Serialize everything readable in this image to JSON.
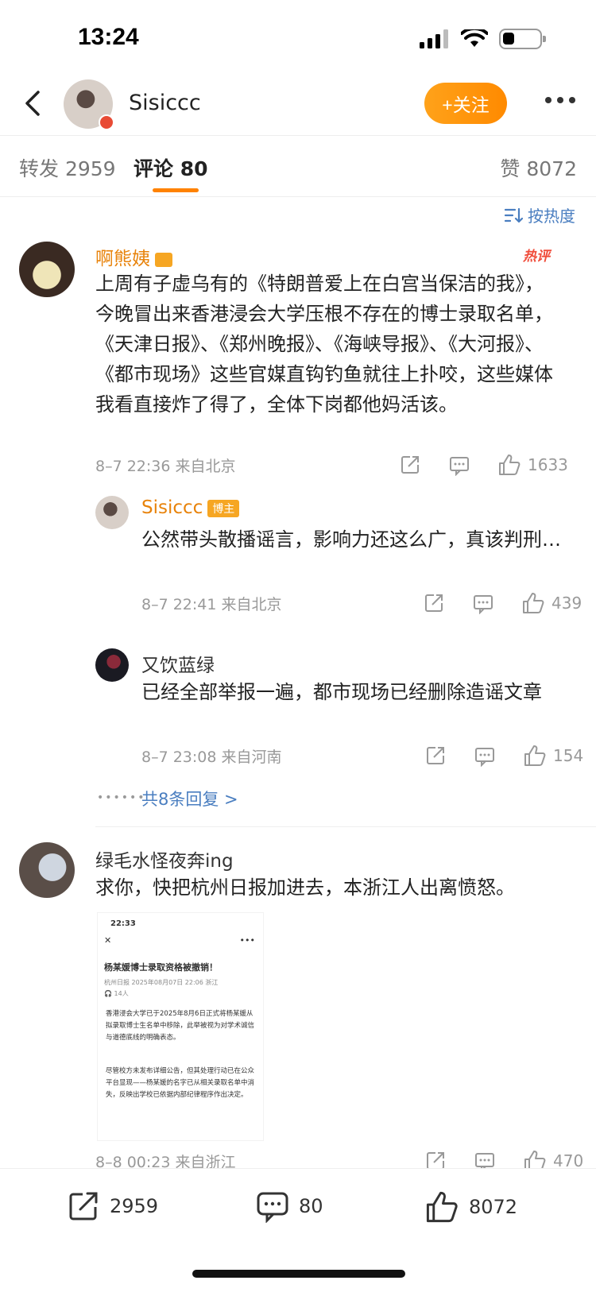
{
  "status": {
    "time": "13:24"
  },
  "header": {
    "user_name": "Sisiccc",
    "follow_label": "+关注"
  },
  "tabs": [
    {
      "label": "转发 2959"
    },
    {
      "label": "评论 80"
    },
    {
      "label": "赞 8072"
    }
  ],
  "sort_label": "按热度",
  "comments": [
    {
      "name": "啊熊姨",
      "hot_tag": "热评",
      "text": "上周有子虚乌有的《特朗普爱上在白宫当保洁的我》，今晚冒出来香港浸会大学压根不存在的博士录取名单，《天津日报》、《郑州晚报》、《海峡导报》、《大河报》、《都市现场》这些官媒直钩钓鱼就往上扑咬，这些媒体我看直接炸了得了，全体下岗都他妈活该。",
      "meta": "8–7 22:36 来自北京",
      "likes": "1633",
      "replies": [
        {
          "name": "Sisiccc",
          "badge": "博主",
          "text": "公然带头散播谣言，影响力还这么广，真该判刑…",
          "meta": "8–7 22:41 来自北京",
          "likes": "439"
        },
        {
          "name": "又饮蓝绿",
          "text": "已经全部举报一遍，都市现场已经删除造谣文章",
          "meta": "8–7 23:08 来自河南",
          "likes": "154"
        }
      ],
      "more_replies": "共8条回复 >"
    },
    {
      "name": "绿毛水怪夜奔ing",
      "text": "求你，快把杭州日报加进去，本浙江人出离愤怒。",
      "meta": "8–8 00:23 来自浙江",
      "likes": "470",
      "image": {
        "time": "22:33",
        "title": "杨某媛博士录取资格被撤销！",
        "source": "杭州日报  2025年08月07日 22:06  浙江",
        "readers": "14人",
        "para1": "香港浸会大学已于2025年8月6日正式将杨某媛从拟录取博士生名单中移除，此举被视为对学术诚信与道德底线的明确表态。",
        "para2": "尽管校方未发布详细公告，但其处理行动已在公众平台显现——杨某媛的名字已从相关录取名单中消失，反映出学校已依据内部纪律程序作出决定。"
      }
    }
  ],
  "bottom_bar": {
    "reposts": "2959",
    "comments": "80",
    "likes": "8072"
  }
}
